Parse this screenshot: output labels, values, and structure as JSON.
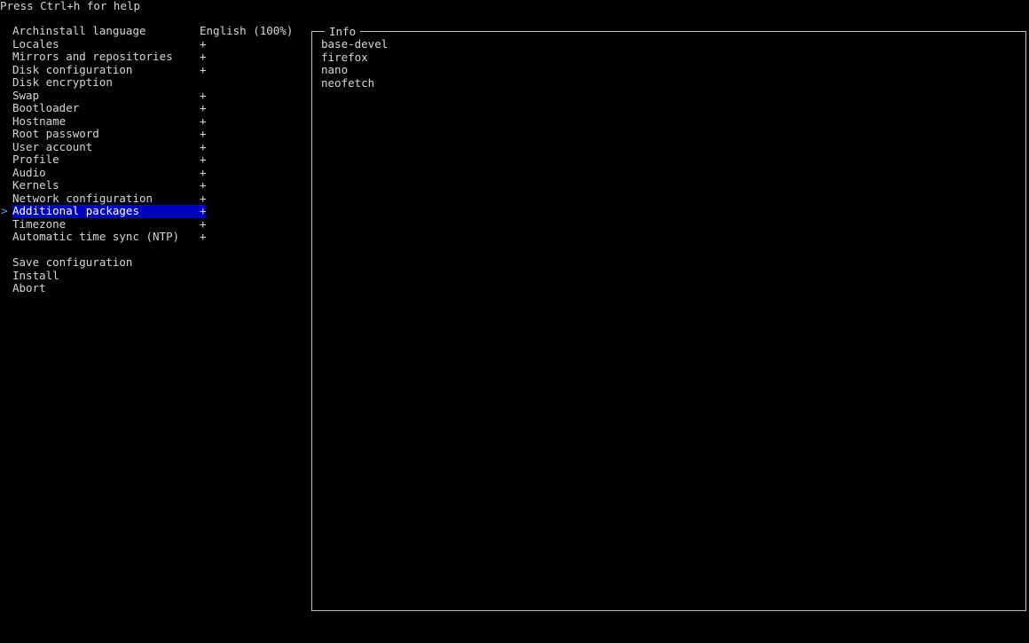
{
  "help_text": "Press Ctrl+h for help",
  "cursor_glyph": ">",
  "menu": {
    "items": [
      {
        "label": "Archinstall language",
        "value": "English (100%)"
      },
      {
        "label": "Locales",
        "value": "+"
      },
      {
        "label": "Mirrors and repositories",
        "value": "+"
      },
      {
        "label": "Disk configuration",
        "value": "+"
      },
      {
        "label": "Disk encryption",
        "value": ""
      },
      {
        "label": "Swap",
        "value": "+"
      },
      {
        "label": "Bootloader",
        "value": "+"
      },
      {
        "label": "Hostname",
        "value": "+"
      },
      {
        "label": "Root password",
        "value": "+"
      },
      {
        "label": "User account",
        "value": "+"
      },
      {
        "label": "Profile",
        "value": "+"
      },
      {
        "label": "Audio",
        "value": "+"
      },
      {
        "label": "Kernels",
        "value": "+"
      },
      {
        "label": "Network configuration",
        "value": "+"
      },
      {
        "label": "Additional packages",
        "value": "+"
      },
      {
        "label": "Timezone",
        "value": "+"
      },
      {
        "label": "Automatic time sync (NTP)",
        "value": "+"
      }
    ],
    "selected_index": 14,
    "actions": [
      {
        "label": "Save configuration"
      },
      {
        "label": "Install"
      },
      {
        "label": "Abort"
      }
    ]
  },
  "info": {
    "title": "Info",
    "packages": [
      "base-devel",
      "firefox",
      "nano",
      "neofetch"
    ]
  },
  "colors": {
    "background": "#000000",
    "text": "#d6d6d6",
    "selection": "#0000c0",
    "cursor": "#4aa8d8",
    "border": "#bcbcbc"
  }
}
